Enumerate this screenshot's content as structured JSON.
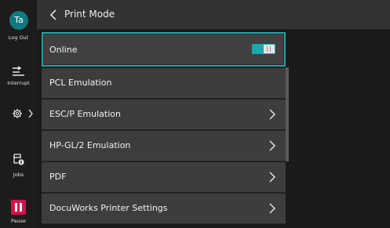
{
  "rail": {
    "user_initials": "Ta",
    "logout_label": "Log Out",
    "interrupt_label": "Interrupt",
    "jobs_label": "Jobs",
    "pause_label": "Pause"
  },
  "header": {
    "title": "Print Mode"
  },
  "list": {
    "online": {
      "label": "Online",
      "toggle_on": true
    },
    "items": [
      {
        "label": "PCL Emulation",
        "has_chevron": false
      },
      {
        "label": "ESC/P Emulation",
        "has_chevron": true
      },
      {
        "label": "HP-GL/2 Emulation",
        "has_chevron": true
      },
      {
        "label": "PDF",
        "has_chevron": true
      },
      {
        "label": "DocuWorks Printer Settings",
        "has_chevron": true
      }
    ]
  },
  "colors": {
    "accent": "#1fa3a6",
    "avatar": "#117a80",
    "pause": "#d0144d"
  }
}
